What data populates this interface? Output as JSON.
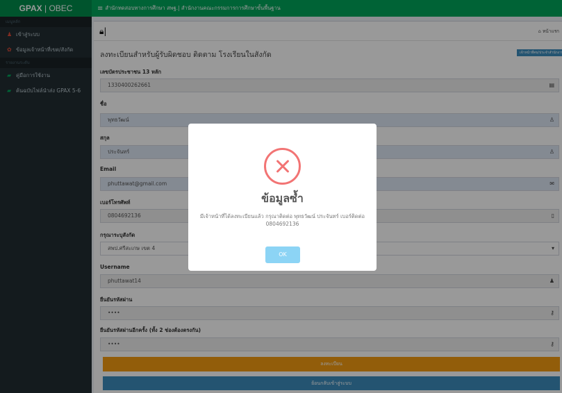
{
  "header": {
    "brand_bold": "GPAX",
    "brand_rest": " | OBEC",
    "title": "สำนักทดสอบทางการศึกษา สพฐ.| สำนักงานคณะกรรมการการศึกษาขั้นพื้นฐาน"
  },
  "sidebar": {
    "section1": "เมนูหลัก",
    "items1": [
      {
        "label": "เข้าสู่ระบบ",
        "icon": "user-icon"
      },
      {
        "label": "ข้อมูลเจ้าหน้าที่เขต/สังกัด",
        "icon": "users-icon"
      }
    ],
    "section2": "รายงานระดับ",
    "items2": [
      {
        "label": "คู่มือการใช้งาน",
        "icon": "book-icon"
      },
      {
        "label": "ค้นฉบับไฟล์นำส่ง GPAX 5-6",
        "icon": "book-icon"
      }
    ]
  },
  "content": {
    "top_link": "หน้าแรก",
    "form_title": "ลงทะเบียนสำหรับผู้รับผิดชอบ ติดตาม โรงเรียนในสังกัด",
    "corner_button": "เจ้าหน้าที่ศธ/ประจำสำนักงาน",
    "fields": {
      "id_label": "เลขบัตรประชาชน 13 หลัก",
      "id_value": "1330400262661",
      "first_label": "ชื่อ",
      "first_value": "พุทธวัฒน์",
      "last_label": "สกุล",
      "last_value": "ประจันทร์",
      "email_label": "Email",
      "email_value": "phuttawat@gmail.com",
      "phone_label": "เบอร์โทรศัพท์",
      "phone_value": "0804692136",
      "area_label": "กรุณาระบุสังกัด",
      "area_value": "สพป.ศรีสะเกษ เขต 4",
      "user_label": "Username",
      "user_value": "phuttawat14",
      "pass_label": "ยืนยันรหัสผ่าน",
      "pass_value": "••••",
      "pass2_label": "ยืนยันรหัสผ่านอีกครั้ง (ทั้ง 2 ช่องต้องตรงกัน)",
      "pass2_value": "••••"
    },
    "register_button": "ลงทะเบียน",
    "back_button": "ย้อนกลับเข้าสู่ระบบ"
  },
  "modal": {
    "title": "ข้อมูลซ้ำ",
    "message": "มีเจ้าหน้าที่ได้ลงทะเบียนแล้ว กรุณาติดต่อ พุทธวัฒน์ ประจันทร์ เบอร์ติดต่อ 0804692136",
    "ok_label": "OK",
    "error_color": "#f27474",
    "ok_color": "#8cd4f5"
  }
}
